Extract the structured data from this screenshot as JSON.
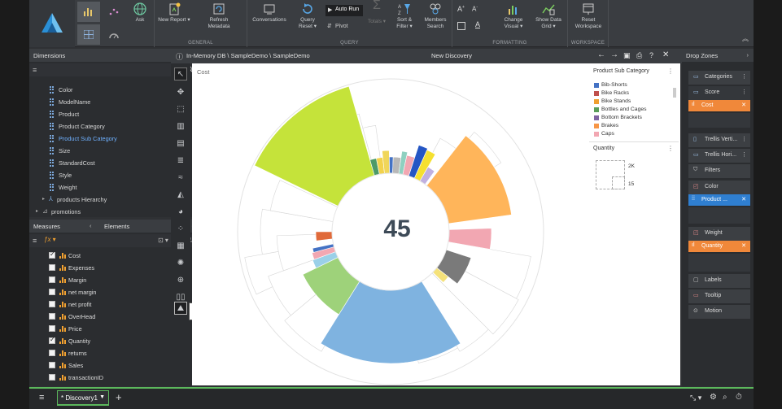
{
  "ribbon": {
    "groups": {
      "general": "GENERAL",
      "query": "QUERY",
      "formatting": "FORMATTING",
      "workspace": "WORKSPACE"
    },
    "buttons": {
      "ask": "Ask",
      "new_report": "New Report ▾",
      "refresh_metadata": "Refresh Metadata",
      "conversations": "Conversations",
      "query_reset": "Query Reset ▾",
      "auto_run": "Auto Run",
      "pivot": "Pivot",
      "totals": "Totals ▾",
      "sort_filter": "Sort & Filter ▾",
      "members_search": "Members Search",
      "change_visual": "Change Visual ▾",
      "show_data_grid": "Show Data Grid ▾",
      "reset_workspace": "Reset Workspace"
    }
  },
  "dimensions": {
    "header": "Dimensions",
    "items": [
      "Color",
      "ModelName",
      "Product",
      "Product Category",
      "Product Sub Category",
      "Size",
      "StandardCost",
      "Style",
      "Weight"
    ],
    "hierarchy": "products Hierarchy",
    "table": "promotions"
  },
  "measures": {
    "header": "Measures",
    "elements_tab": "Elements",
    "items": [
      {
        "label": "Cost",
        "checked": true
      },
      {
        "label": "Expenses",
        "checked": false
      },
      {
        "label": "Margin",
        "checked": false
      },
      {
        "label": "net margin",
        "checked": false
      },
      {
        "label": "net profit",
        "checked": false
      },
      {
        "label": "OverHead",
        "checked": false
      },
      {
        "label": "Price",
        "checked": false
      },
      {
        "label": "Quantity",
        "checked": true
      },
      {
        "label": "returns",
        "checked": false
      },
      {
        "label": "Sales",
        "checked": false
      },
      {
        "label": "transactionID",
        "checked": false
      }
    ]
  },
  "canvas": {
    "breadcrumb": "In-Memory DB \\ SampleDemo \\ SampleDemo",
    "title": "New Discovery",
    "chart_label": "Cost",
    "center_value": "45"
  },
  "legend": {
    "title": "Product Sub Category",
    "items": [
      {
        "label": "Bib-Shorts",
        "color": "#4472c4"
      },
      {
        "label": "Bike Racks",
        "color": "#c0504d"
      },
      {
        "label": "Bike Stands",
        "color": "#f0a030"
      },
      {
        "label": "Bottles and Cages",
        "color": "#5a9e5a"
      },
      {
        "label": "Bottom Brackets",
        "color": "#8064a2"
      },
      {
        "label": "Brakes",
        "color": "#f79646"
      },
      {
        "label": "Caps",
        "color": "#f2a7b2"
      }
    ],
    "size_title": "Quantity",
    "size_max": "2K",
    "size_min": "15"
  },
  "dropzones": {
    "header": "Drop Zones",
    "categories": "Categories",
    "score": "Score",
    "score_pill": "Cost",
    "trellis_vertical": "Trellis Verti...",
    "trellis_horizontal": "Trellis Hori...",
    "filters": "Filters",
    "color": "Color",
    "color_pill": "Product ...",
    "weight": "Weight",
    "weight_pill": "Quantity",
    "labels": "Labels",
    "tooltip": "Tooltip",
    "motion": "Motion"
  },
  "statusbar": {
    "tab": "* Discovery1"
  },
  "colors": {
    "accent_green": "#5cb85c",
    "pill_orange": "#f0883a",
    "pill_blue": "#2f7fd1",
    "link_blue": "#6fb1ff"
  }
}
